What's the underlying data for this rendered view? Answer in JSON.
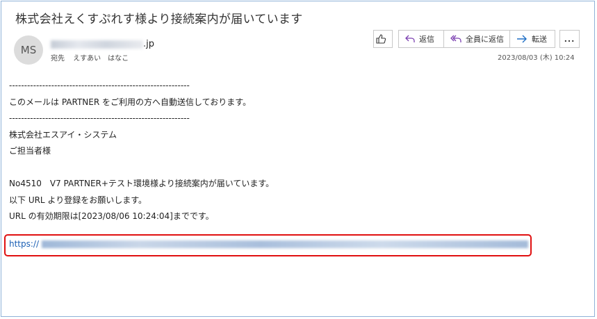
{
  "email": {
    "subject": "株式会社えくすぷれす様より接続案内が届いています",
    "avatar_initials": "MS",
    "sender_domain": ".jp",
    "to_label": "宛先",
    "to_name": "えすあい　はなこ",
    "date": "2023/08/03 (木) 10:24"
  },
  "toolbar": {
    "like_icon": "thumbs-up-icon",
    "reply_label": "返信",
    "reply_all_label": "全員に返信",
    "forward_label": "転送",
    "more_label": "..."
  },
  "body": {
    "lines": [
      "------------------------------------------------------------",
      "このメールは PARTNER をご利用の方へ自動送信しております。",
      "------------------------------------------------------------",
      "株式会社エスアイ・システム",
      "ご担当者様",
      "",
      "No4510　V7 PARTNER+テスト環境様より接続案内が届いています。",
      "以下 URL より登録をお願いします。",
      "URL の有効期限は[2023/08/06 10:24:04]までです。"
    ],
    "link_prefix": "https://"
  },
  "colors": {
    "highlight": "#e01010",
    "link": "#1a5fb4",
    "frame": "#8fb2d8"
  }
}
